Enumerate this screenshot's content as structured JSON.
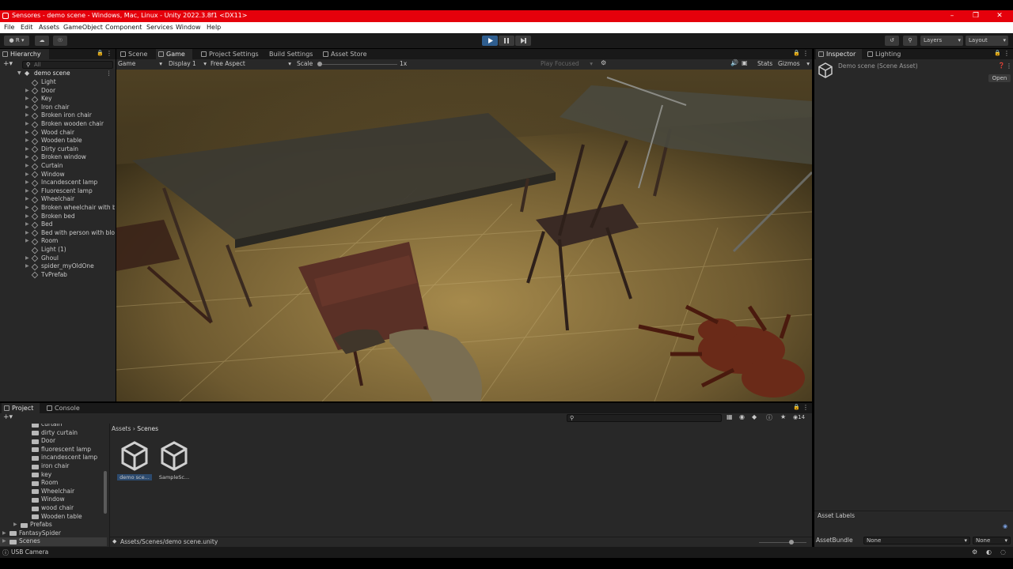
{
  "window": {
    "title": "Sensores - demo scene - Windows, Mac, Linux - Unity 2022.3.8f1 <DX11>",
    "minimize": "–",
    "maximize": "❐",
    "close": "✕"
  },
  "menu": [
    "File",
    "Edit",
    "Assets",
    "GameObject",
    "Component",
    "Services",
    "Window",
    "Help"
  ],
  "toolbar": {
    "account_label": "R",
    "layers_label": "Layers",
    "layout_label": "Layout"
  },
  "hierarchy": {
    "tab_label": "Hierarchy",
    "search_placeholder": "All",
    "scene_name": "demo scene",
    "items": [
      {
        "label": "Light",
        "expandable": false
      },
      {
        "label": "Door",
        "expandable": true
      },
      {
        "label": "Key",
        "expandable": true
      },
      {
        "label": "Iron chair",
        "expandable": true
      },
      {
        "label": "Broken iron chair",
        "expandable": true
      },
      {
        "label": "Broken wooden chair",
        "expandable": true
      },
      {
        "label": "Wood chair",
        "expandable": true
      },
      {
        "label": "Wooden table",
        "expandable": true
      },
      {
        "label": "Dirty curtain",
        "expandable": true
      },
      {
        "label": "Broken window",
        "expandable": true
      },
      {
        "label": "Curtain",
        "expandable": true
      },
      {
        "label": "Window",
        "expandable": true
      },
      {
        "label": "Incandescent lamp",
        "expandable": true
      },
      {
        "label": "Fluorescent lamp",
        "expandable": true
      },
      {
        "label": "Wheelchair",
        "expandable": true
      },
      {
        "label": "Broken wheelchair with b",
        "expandable": true
      },
      {
        "label": "Broken bed",
        "expandable": true
      },
      {
        "label": "Bed",
        "expandable": true
      },
      {
        "label": "Bed with person with blo",
        "expandable": true
      },
      {
        "label": "Room",
        "expandable": true
      },
      {
        "label": "Light (1)",
        "expandable": false
      },
      {
        "label": "Ghoul",
        "expandable": true
      },
      {
        "label": "spider_myOldOne",
        "expandable": true
      },
      {
        "label": "TvPrefab",
        "expandable": false
      }
    ]
  },
  "center_tabs": [
    "Scene",
    "Game",
    "Project Settings",
    "Build Settings",
    "Asset Store"
  ],
  "game_bar": {
    "mode": "Game",
    "display": "Display 1",
    "aspect": "Free Aspect",
    "scale_label": "Scale",
    "scale_value": "1x",
    "play_focused": "Play Focused",
    "stats": "Stats",
    "gizmos": "Gizmos"
  },
  "inspector": {
    "tabs": [
      "Inspector",
      "Lighting"
    ],
    "object_name": "Demo scene (Scene Asset)",
    "open_button": "Open",
    "asset_labels": "Asset Labels",
    "asset_bundle_label": "AssetBundle",
    "asset_bundle_value": "None",
    "asset_bundle_variant": "None"
  },
  "project": {
    "tabs": [
      "Project",
      "Console"
    ],
    "tree": [
      {
        "label": "curtain",
        "indent": 2
      },
      {
        "label": "dirty curtain",
        "indent": 2
      },
      {
        "label": "Door",
        "indent": 2
      },
      {
        "label": "fluorescent lamp",
        "indent": 2
      },
      {
        "label": "incandescent lamp",
        "indent": 2
      },
      {
        "label": "iron chair",
        "indent": 2
      },
      {
        "label": "key",
        "indent": 2
      },
      {
        "label": "Room",
        "indent": 2
      },
      {
        "label": "Wheelchair",
        "indent": 2
      },
      {
        "label": "Window",
        "indent": 2
      },
      {
        "label": "wood chair",
        "indent": 2
      },
      {
        "label": "Wooden table",
        "indent": 2
      },
      {
        "label": "Prefabs",
        "indent": 1
      },
      {
        "label": "FantasySpider",
        "indent": 0
      },
      {
        "label": "Scenes",
        "indent": 0
      }
    ],
    "breadcrumb": [
      "Assets",
      "Scenes"
    ],
    "assets": [
      "demo sce...",
      "SampleSc..."
    ],
    "path": "Assets/Scenes/demo scene.unity",
    "hidden_count": "14"
  },
  "status": {
    "message": "USB Camera"
  }
}
